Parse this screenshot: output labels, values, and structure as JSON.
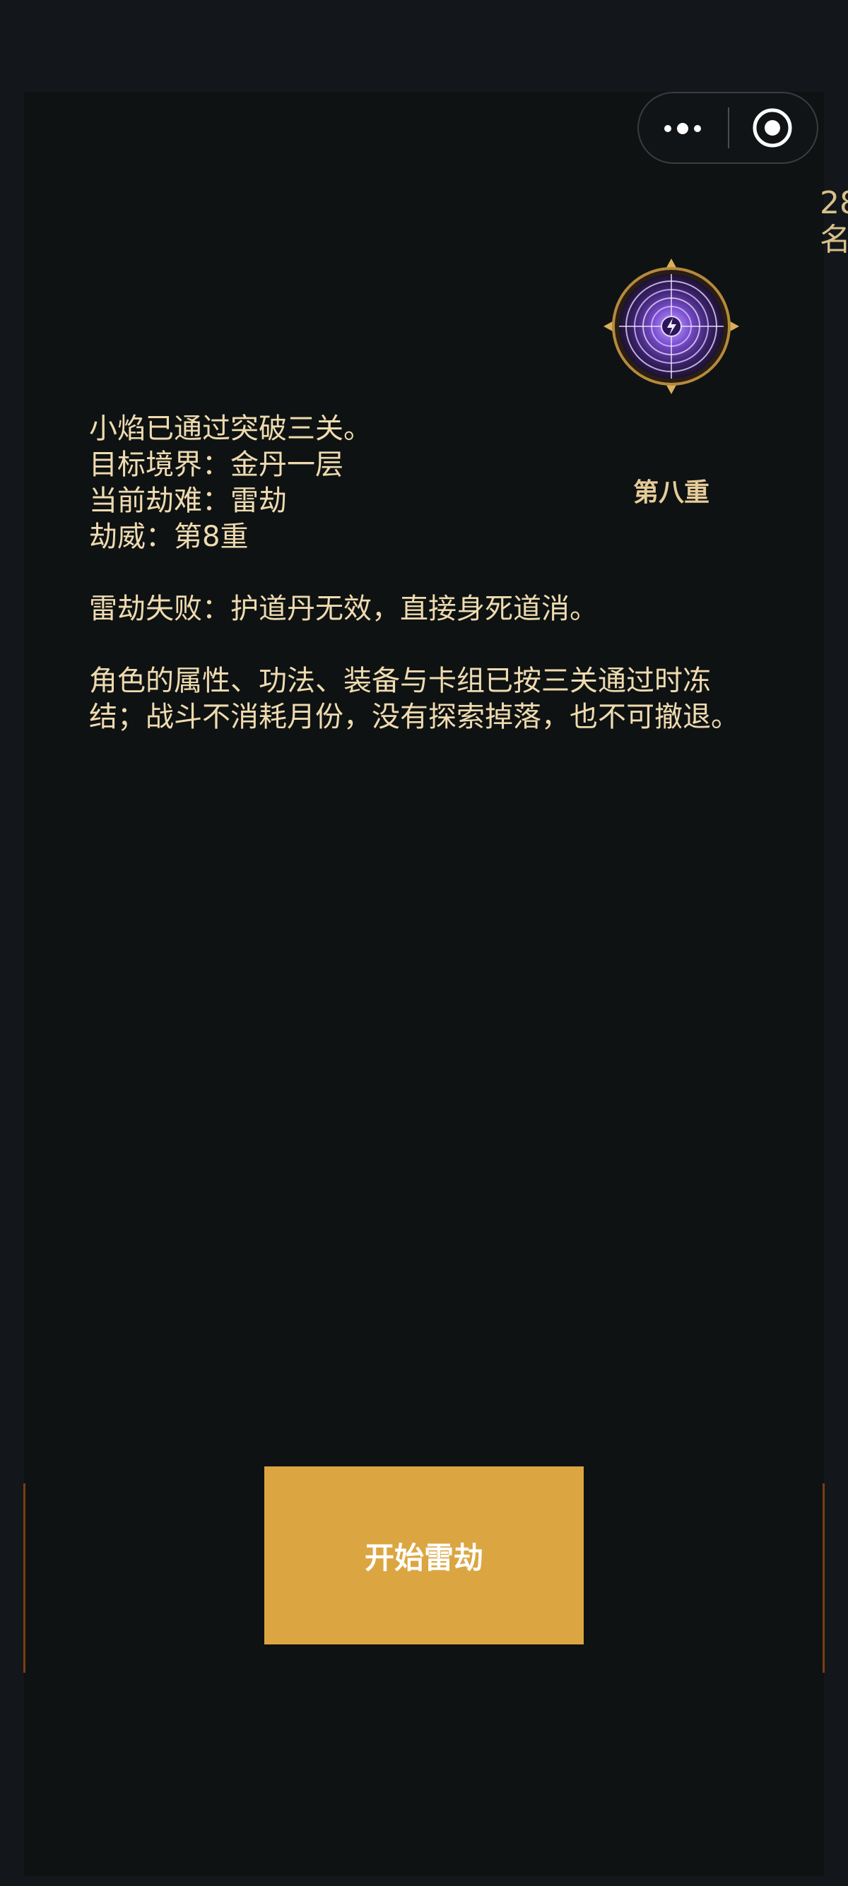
{
  "capsule": {
    "more_icon": "more-dots-icon",
    "close_icon": "target-circle-icon"
  },
  "edge_text": {
    "line1": "28",
    "line2": "名"
  },
  "tribulation": {
    "emblem_icon": "purple-lightning-seal-icon",
    "tier_label": "第八重",
    "lines": [
      "小焰已通过突破三关。",
      "目标境界：金丹一层",
      "当前劫难：雷劫",
      "劫威：第8重"
    ],
    "failure_text": "雷劫失败：护道丹无效，直接身死道消。",
    "note_text": "角色的属性、功法、装备与卡组已按三关通过时冻结；战斗不消耗月份，没有探索掉落，也不可撤退。"
  },
  "actions": {
    "start_label": "开始雷劫"
  },
  "colors": {
    "background": "#13171b",
    "panel": "#0f1212",
    "text": "#eedbb0",
    "accent": "#dba641",
    "emblem_purple": "#8a5ee0"
  }
}
